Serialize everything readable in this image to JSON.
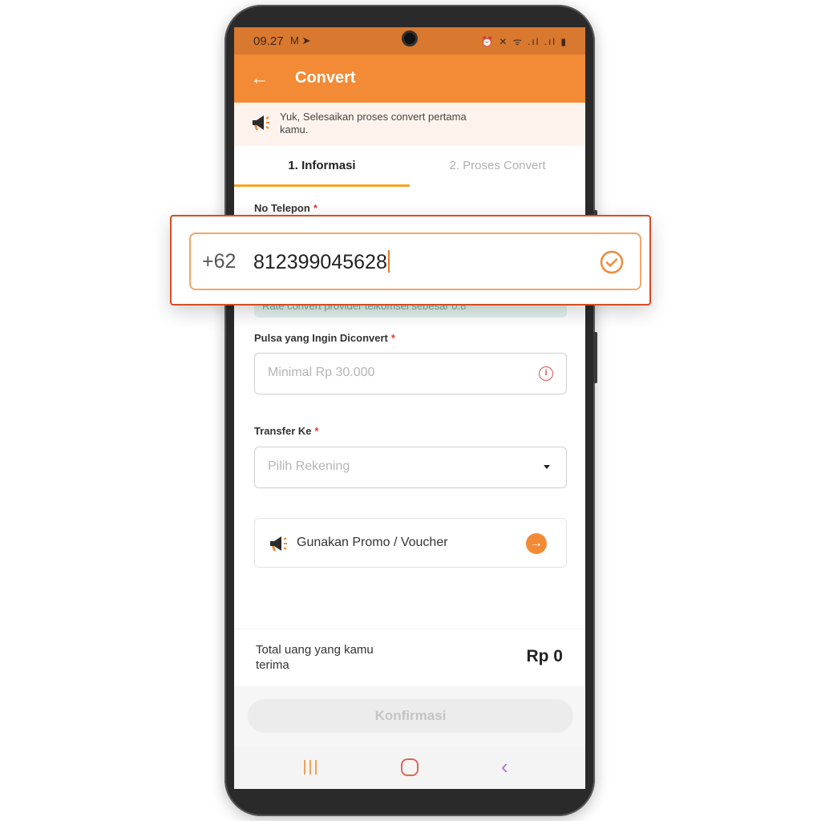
{
  "status_bar": {
    "time": "09.27",
    "left_icons": "M ➤",
    "right_icons": "⏰ ✕ ᯤ .ıl .ıl ▮"
  },
  "header": {
    "title": "Convert",
    "back_icon": "arrow-left-icon"
  },
  "banner": {
    "text": "Yuk, Selesaikan proses convert pertama kamu."
  },
  "tabs": [
    {
      "label": "1. Informasi",
      "active": true
    },
    {
      "label": "2. Proses Convert",
      "active": false
    }
  ],
  "form": {
    "phone": {
      "label": "No Telepon",
      "required_mark": "*",
      "prefix": "+62",
      "value": "812399045628"
    },
    "rate_note": "Rate convert provider telkomsel sebesar 0.8",
    "pulsa": {
      "label": "Pulsa yang Ingin Diconvert",
      "required_mark": "*",
      "placeholder": "Minimal Rp 30.000"
    },
    "transfer": {
      "label": "Transfer Ke",
      "required_mark": "*",
      "placeholder": "Pilih Rekening"
    },
    "promo": {
      "label": "Gunakan Promo / Voucher"
    }
  },
  "total": {
    "label": "Total uang yang kamu terima",
    "value": "Rp 0"
  },
  "confirm_button": "Konfirmasi",
  "colors": {
    "primary": "#f28a36",
    "status_bar": "#d9782f",
    "highlight_border": "#d94c24",
    "tab_underline": "#f5a623"
  }
}
